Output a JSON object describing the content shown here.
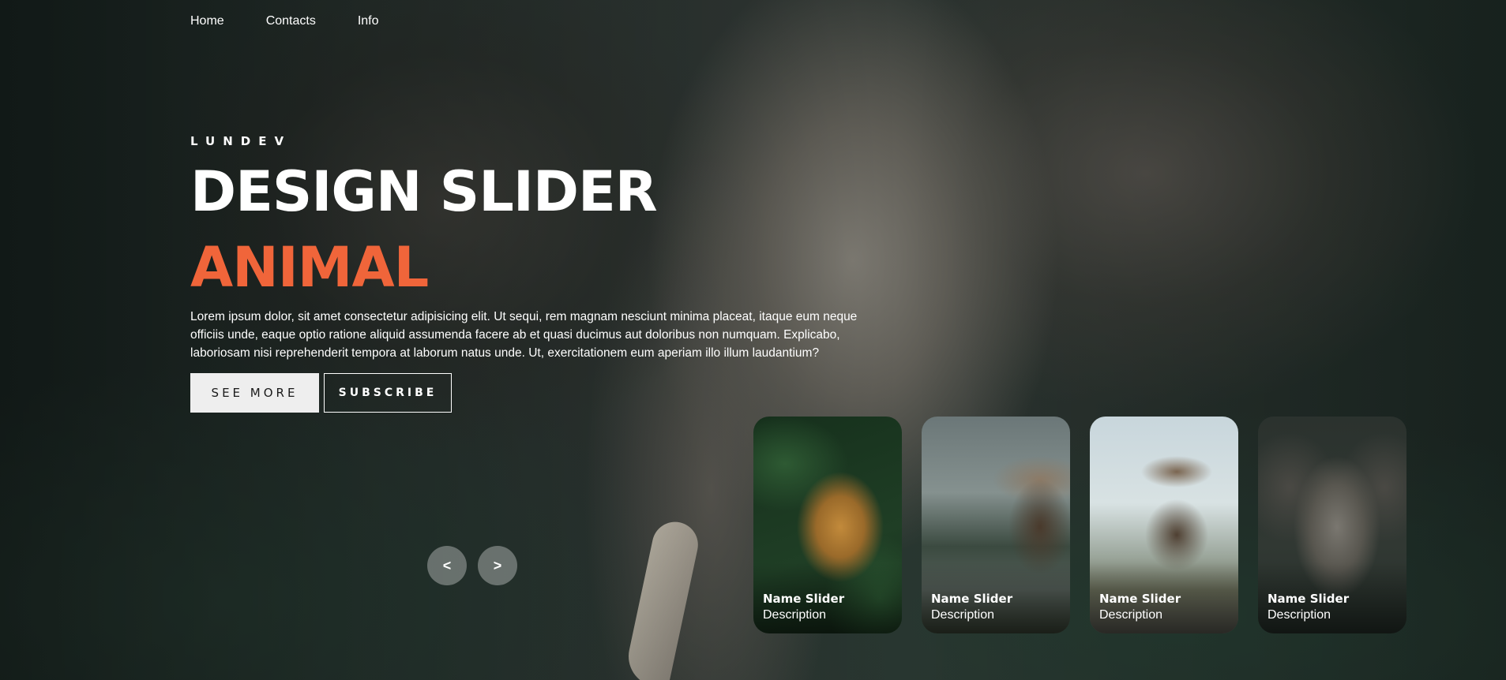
{
  "nav": {
    "items": [
      "Home",
      "Contacts",
      "Info"
    ]
  },
  "hero": {
    "author": "LUNDEV",
    "title": "DESIGN SLIDER",
    "topic": "ANIMAL",
    "description": "Lorem ipsum dolor, sit amet consectetur adipisicing elit. Ut sequi, rem magnam nesciunt minima placeat, itaque eum neque officiis unde, eaque optio ratione aliquid assumenda facere ab et quasi ducimus aut doloribus non numquam. Explicabo, laboriosam nisi reprehenderit tempora at laborum natus unde. Ut, exercitationem eum aperiam illo illum laudantium?",
    "buttons": {
      "see_more": "SEE MORE",
      "subscribe": "SUBSCRIBE"
    }
  },
  "arrows": {
    "prev": "<",
    "next": ">"
  },
  "thumbnails": [
    {
      "title": "Name Slider",
      "description": "Description",
      "subject": "leopard"
    },
    {
      "title": "Name Slider",
      "description": "Description",
      "subject": "moose"
    },
    {
      "title": "Name Slider",
      "description": "Description",
      "subject": "moose"
    },
    {
      "title": "Name Slider",
      "description": "Description",
      "subject": "elephant"
    }
  ],
  "colors": {
    "accent": "#f0653a",
    "text": "#ffffff",
    "button_bg": "#eeeeee"
  },
  "background_subject": "elephant-in-jungle"
}
